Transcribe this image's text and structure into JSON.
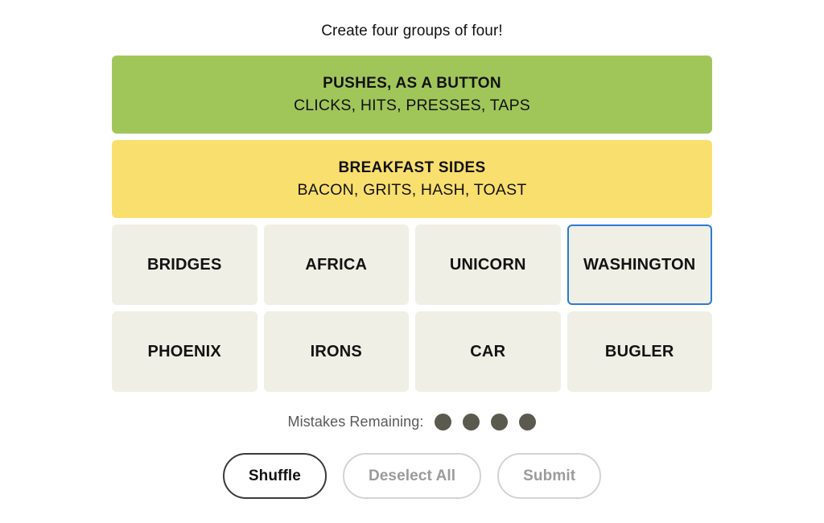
{
  "instruction": "Create four groups of four!",
  "solved_groups": [
    {
      "title": "PUSHES, AS A BUTTON",
      "members": "CLICKS, HITS, PRESSES, TAPS",
      "color": "#a0c65a"
    },
    {
      "title": "BREAKFAST SIDES",
      "members": "BACON, GRITS, HASH, TOAST",
      "color": "#f9df6d"
    }
  ],
  "tiles": [
    [
      {
        "label": "BRIDGES",
        "focused": false
      },
      {
        "label": "AFRICA",
        "focused": false
      },
      {
        "label": "UNICORN",
        "focused": false
      },
      {
        "label": "WASHINGTON",
        "focused": true
      }
    ],
    [
      {
        "label": "PHOENIX",
        "focused": false
      },
      {
        "label": "IRONS",
        "focused": false
      },
      {
        "label": "CAR",
        "focused": false
      },
      {
        "label": "BUGLER",
        "focused": false
      }
    ]
  ],
  "mistakes": {
    "label": "Mistakes Remaining:",
    "remaining": 4,
    "dot_color": "#5a5a4e"
  },
  "buttons": [
    {
      "label": "Shuffle",
      "enabled": true
    },
    {
      "label": "Deselect All",
      "enabled": false
    },
    {
      "label": "Submit",
      "enabled": false
    }
  ],
  "theme": {
    "tile_background": "#efefe6",
    "focus_ring": "#2b7ad6",
    "text": "#121212"
  }
}
